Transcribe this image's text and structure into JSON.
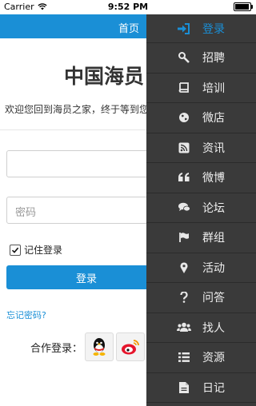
{
  "status_bar": {
    "carrier": "Carrier",
    "time": "9:52 PM"
  },
  "top_bar": {
    "home_label": "首页"
  },
  "page": {
    "title": "中国海员",
    "welcome_text": "欢迎您回到海员之家，终于等到您",
    "username_placeholder": "",
    "password_placeholder": "密码",
    "remember_label": "记住登录",
    "remember_checked": true,
    "login_button": "登录",
    "forgot_link": "忘记密码?",
    "third_party_label": "合作登录："
  },
  "drawer": {
    "items": [
      {
        "label": "登录",
        "icon": "sign-in-icon",
        "active": true
      },
      {
        "label": "招聘",
        "icon": "wrench-icon"
      },
      {
        "label": "培训",
        "icon": "book-icon"
      },
      {
        "label": "微店",
        "icon": "globe-icon"
      },
      {
        "label": "资讯",
        "icon": "rss-icon"
      },
      {
        "label": "微博",
        "icon": "quote-icon"
      },
      {
        "label": "论坛",
        "icon": "comments-icon"
      },
      {
        "label": "群组",
        "icon": "flag-icon"
      },
      {
        "label": "活动",
        "icon": "map-marker-icon"
      },
      {
        "label": "问答",
        "icon": "question-icon"
      },
      {
        "label": "找人",
        "icon": "users-icon"
      },
      {
        "label": "资源",
        "icon": "list-icon"
      },
      {
        "label": "日记",
        "icon": "file-icon"
      }
    ]
  },
  "colors": {
    "accent": "#1a8fd6",
    "drawer_bg": "#3a3a3a"
  }
}
